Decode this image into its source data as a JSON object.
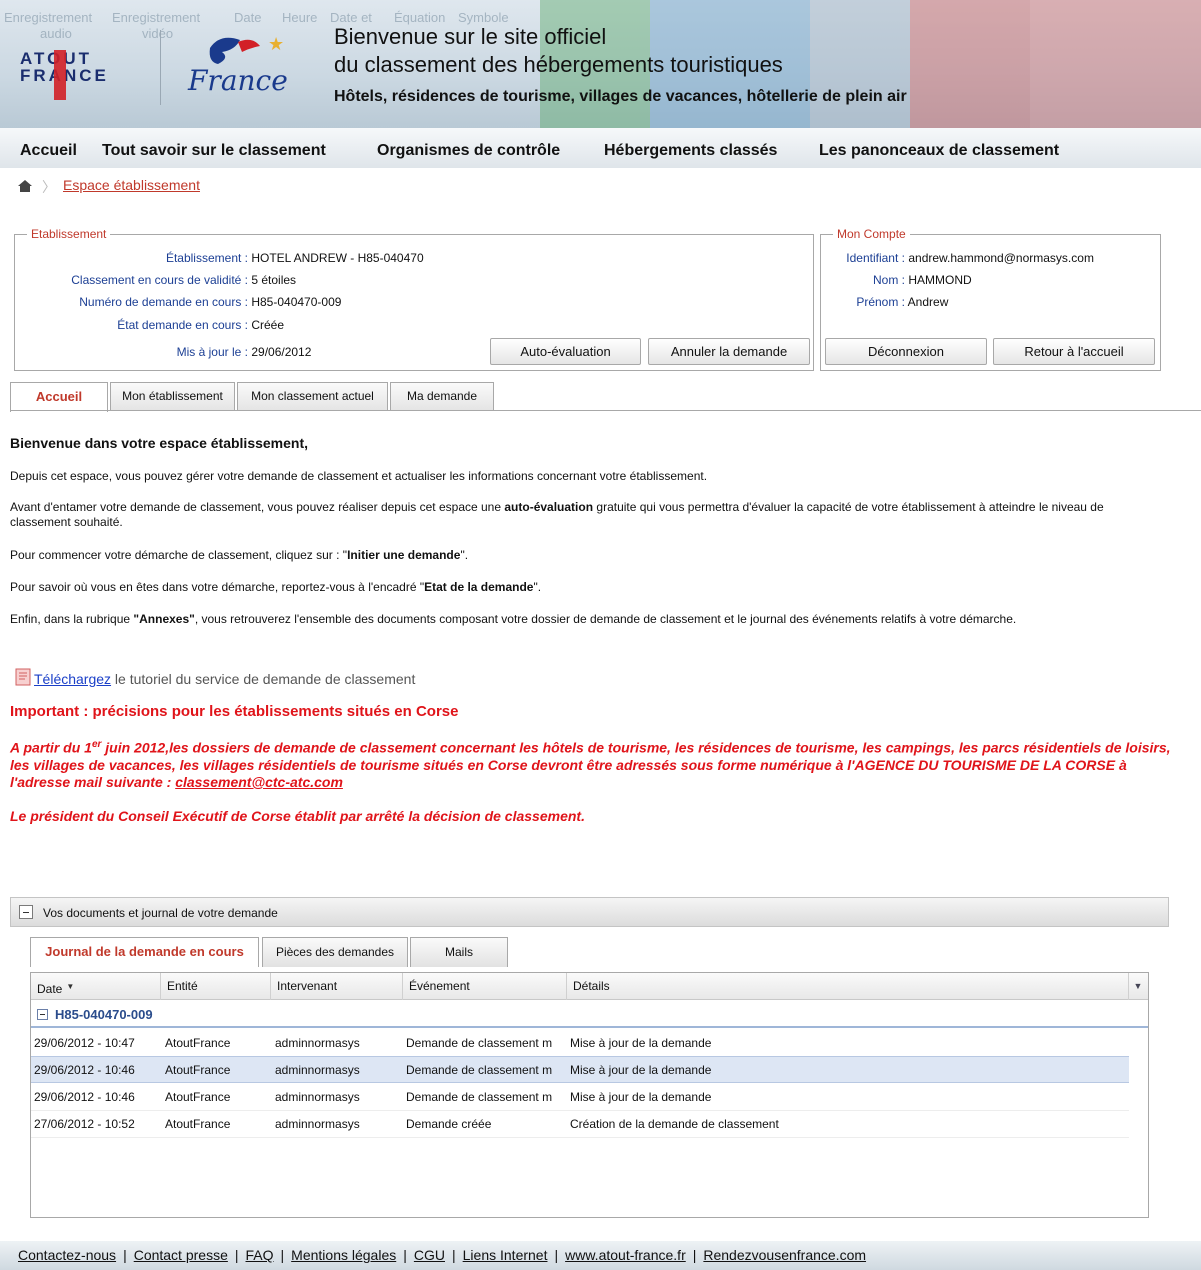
{
  "header": {
    "logo_line1": "ATOUT",
    "logo_line2": "FRANCE",
    "logo_script": "France",
    "title_line1": "Bienvenue sur le site officiel",
    "title_line2": "du classement des hébergements touristiques",
    "subtitle": "Hôtels, résidences de tourisme, villages de vacances, hôtellerie de plein air",
    "ghost_text": [
      "Enregistrement",
      "Enregistrement",
      "audio",
      "vidéo",
      "Date",
      "Heure",
      "Date et",
      "Équation",
      "Symbole"
    ]
  },
  "nav": {
    "items": [
      "Accueil",
      "Tout savoir sur le classement",
      "Organismes de contrôle",
      "Hébergements classés",
      "Les panonceaux de classement"
    ]
  },
  "breadcrumb": {
    "home_icon": "home-icon",
    "current": "Espace établissement"
  },
  "etablissement": {
    "legend": "Etablissement",
    "rows": [
      {
        "label": "Établissement :",
        "value": "HOTEL ANDREW - H85-040470"
      },
      {
        "label": "Classement en cours de validité :",
        "value": "5 étoiles"
      },
      {
        "label": "Numéro de demande en cours :",
        "value": "H85-040470-009"
      },
      {
        "label": "État demande en cours :",
        "value": "Créée"
      },
      {
        "label": "Mis à jour le :",
        "value": "29/06/2012"
      }
    ],
    "buttons": {
      "auto_eval": "Auto-évaluation",
      "cancel": "Annuler la demande"
    }
  },
  "compte": {
    "legend": "Mon Compte",
    "rows": [
      {
        "label": "Identifiant :",
        "value": "andrew.hammond@normasys.com"
      },
      {
        "label": "Nom :",
        "value": "HAMMOND"
      },
      {
        "label": "Prénom :",
        "value": "Andrew"
      }
    ],
    "buttons": {
      "logout": "Déconnexion",
      "home": "Retour à l'accueil"
    }
  },
  "tabs": [
    "Accueil",
    "Mon établissement",
    "Mon classement actuel",
    "Ma demande"
  ],
  "content": {
    "welcome": "Bienvenue dans votre espace établissement,",
    "p1": "Depuis cet espace, vous pouvez gérer votre demande de classement et actualiser les informations concernant votre établissement.",
    "p2_a": "Avant d'entamer votre demande de classement, vous pouvez réaliser depuis cet espace une ",
    "p2_b": "auto-évaluation",
    "p2_c": " gratuite qui vous permettra d'évaluer la capacité de votre établissement à atteindre le niveau de classement souhaité.",
    "p3_a": "Pour commencer votre démarche de classement, cliquez sur : \"",
    "p3_b": "Initier une demande",
    "p3_c": "\".",
    "p4_a": "Pour savoir où vous en  êtes dans votre démarche, reportez-vous à l'encadré \"",
    "p4_b": "Etat de la demande",
    "p4_c": "\".",
    "p5_a": "Enfin, dans la rubrique ",
    "p5_b": "\"Annexes\"",
    "p5_c": ", vous retrouverez l'ensemble des documents composant votre dossier de demande de classement et le journal des événements relatifs à votre démarche.",
    "download_link": "Téléchargez",
    "download_text": " le tutoriel du service de demande de classement",
    "important_title": "Important : précisions pour les établissements situés en Corse",
    "important_a": "A partir du 1",
    "important_sup": "er",
    "important_b": " juin 2012,les dossiers de demande de classement concernant les hôtels de tourisme, les résidences de tourisme, les campings, les parcs résidentiels de loisirs, les villages de vacances, les villages résidentiels de tourisme situés en Corse  devront être adressés sous forme numérique à l'AGENCE DU TOURISME DE LA CORSE à l'adresse mail suivante : ",
    "important_mail": "classement@ctc-atc.com",
    "president": "Le président du Conseil Exécutif de Corse établit par arrêté la décision de classement."
  },
  "panel": {
    "title": "Vos documents et journal de votre demande",
    "tabs": [
      "Journal de la demande en cours",
      "Pièces des demandes",
      "Mails"
    ],
    "columns": [
      "Date",
      "Entité",
      "Intervenant",
      "Événement",
      "Détails"
    ],
    "group": "H85-040470-009",
    "rows": [
      {
        "date": "29/06/2012 - 10:47",
        "entite": "AtoutFrance",
        "intervenant": "adminnormasys",
        "evenement": "Demande de classement m",
        "details": "Mise à jour de la demande"
      },
      {
        "date": "29/06/2012 - 10:46",
        "entite": "AtoutFrance",
        "intervenant": "adminnormasys",
        "evenement": "Demande de classement m",
        "details": "Mise à jour de la demande"
      },
      {
        "date": "29/06/2012 - 10:46",
        "entite": "AtoutFrance",
        "intervenant": "adminnormasys",
        "evenement": "Demande de classement m",
        "details": "Mise à jour de la demande"
      },
      {
        "date": "27/06/2012 - 10:52",
        "entite": "AtoutFrance",
        "intervenant": "adminnormasys",
        "evenement": "Demande créée",
        "details": "Création de la demande de classement"
      }
    ]
  },
  "footer": {
    "links": [
      "Contactez-nous",
      "Contact presse",
      "FAQ",
      "Mentions légales",
      "CGU",
      "Liens Internet",
      "www.atout-france.fr",
      "Rendezvousenfrance.com"
    ],
    "separator": "|"
  },
  "colors": {
    "accent_red": "#c0392b",
    "label_blue": "#1c3f94",
    "important_red": "#e0141a",
    "link_blue": "#1a3fc8"
  }
}
